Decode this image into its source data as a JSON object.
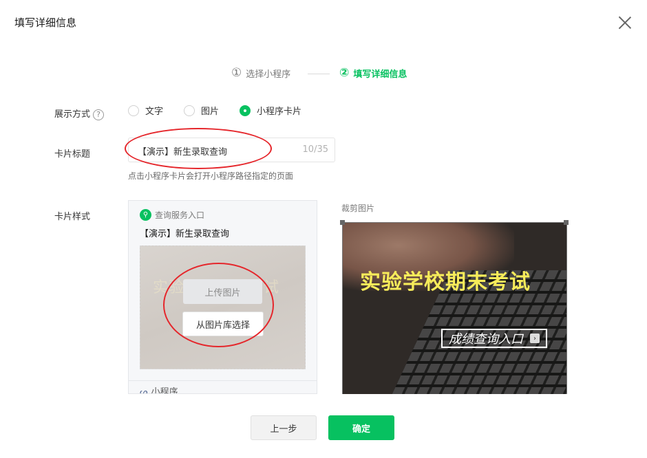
{
  "dialog": {
    "title": "填写详细信息"
  },
  "steps": [
    {
      "num": "①",
      "label": "选择小程序"
    },
    {
      "num": "②",
      "label": "填写详细信息"
    }
  ],
  "form": {
    "display_mode": {
      "label": "展示方式",
      "help": "?",
      "options": [
        "文字",
        "图片",
        "小程序卡片"
      ],
      "selected": "小程序卡片"
    },
    "card_title": {
      "label": "卡片标题",
      "value": "【演示】新生录取查询",
      "count": "10/35",
      "hint": "点击小程序卡片会打开小程序路径指定的页面"
    },
    "card_style": {
      "label": "卡片样式"
    }
  },
  "card_preview": {
    "service": "查询服务入口",
    "title": "【演示】新生录取查询",
    "bg_text": "实验学校期末考试",
    "upload_label": "上传图片",
    "library_label": "从图片库选择",
    "footer": "小程序",
    "search_glyph": "⚲",
    "link_glyph": "ᔕ"
  },
  "crop": {
    "label": "裁剪图片",
    "main_text": "实验学校期末考试",
    "button_text": "成绩查询入口",
    "arrow_glyph": "›"
  },
  "footer": {
    "prev_label": "上一步",
    "ok_label": "确定"
  },
  "colors": {
    "accent": "#07c160",
    "annotation": "#e5262b"
  }
}
